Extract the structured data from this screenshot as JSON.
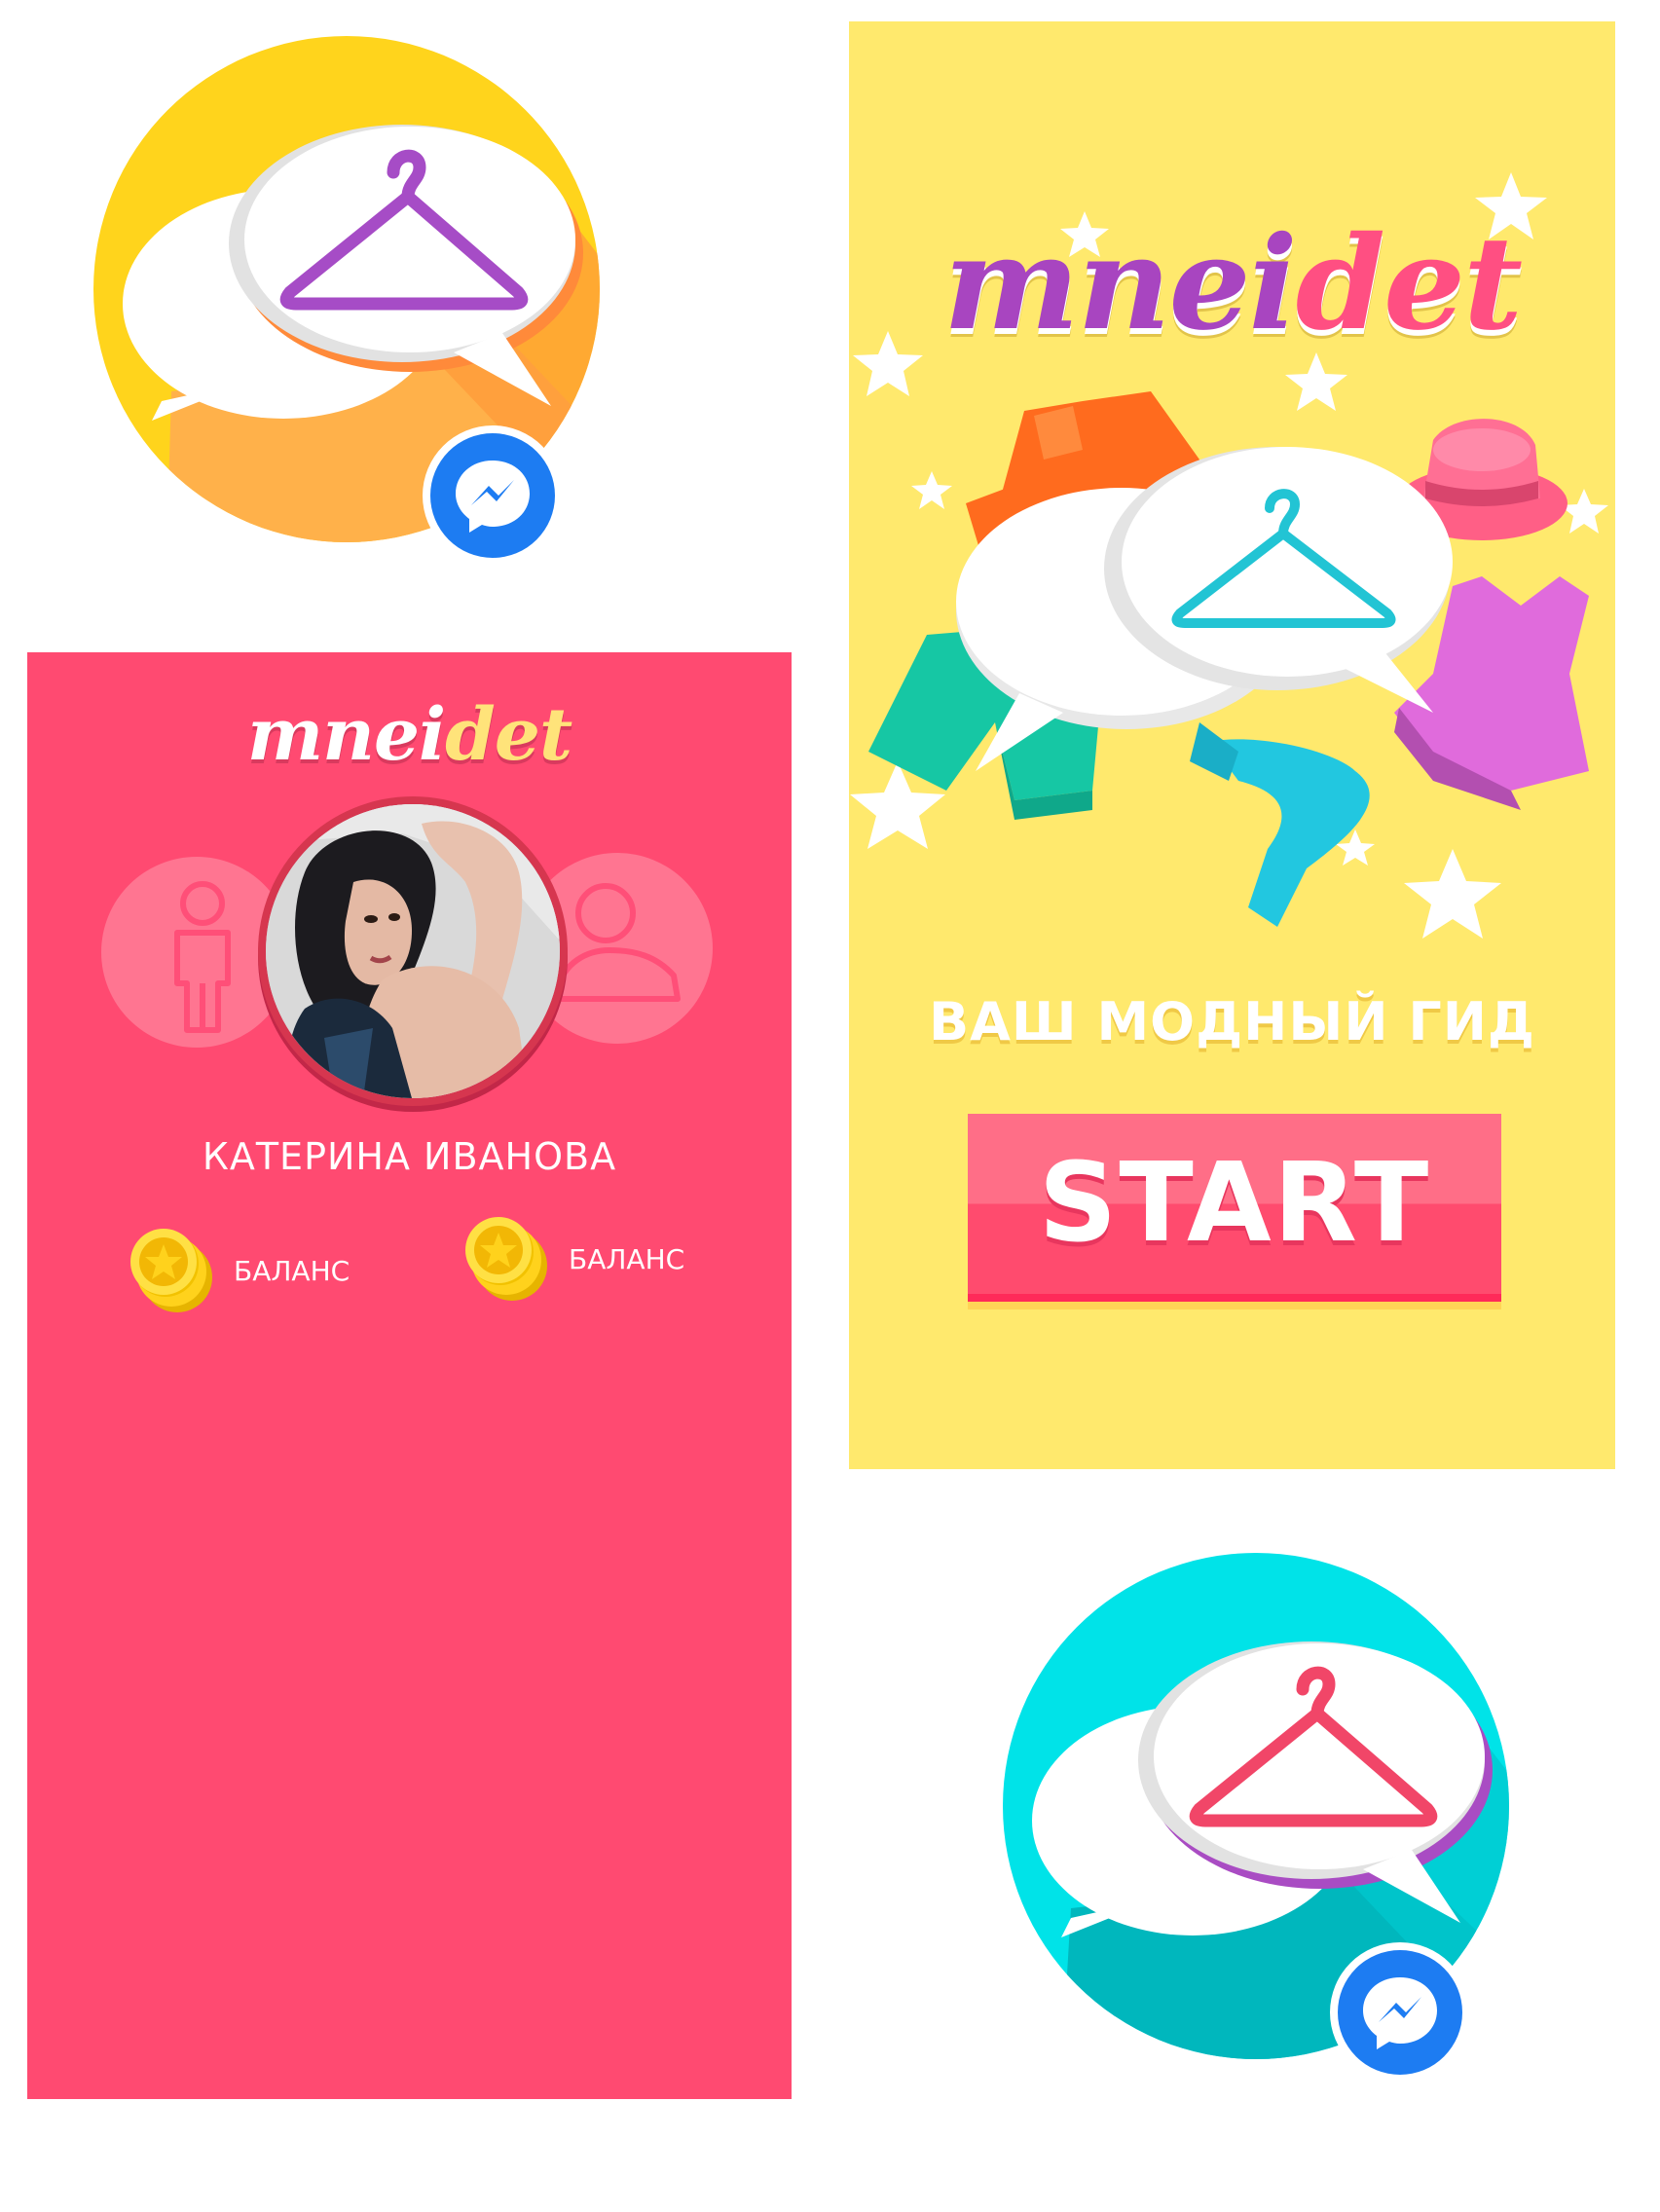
{
  "profile_screen": {
    "logo_part1": "mnei",
    "logo_part2": "det",
    "user_name": "КАТЕРИНА ИВАНОВА",
    "balance_items": [
      {
        "label": "БАЛАНС"
      },
      {
        "label": "БАЛАНС"
      }
    ],
    "colors": {
      "background": "#ff4a71",
      "accent": "#ffe37a"
    }
  },
  "start_screen": {
    "logo_part1": "mnei",
    "logo_part2": "det",
    "tagline": "ВАШ МОДНЫЙ ГИД",
    "start_label": "START",
    "colors": {
      "background": "#ffe96d",
      "button": "#ff4b6e",
      "logo_purple": "#a845c0",
      "logo_pink": "#ff4f82"
    }
  },
  "icons": {
    "top_app_icon": {
      "color": "#ffd41c",
      "hanger_color": "#a64cc6",
      "badge": "messenger-icon"
    },
    "bottom_app_icon": {
      "color": "#00dbe0",
      "hanger_color": "#f14668",
      "badge": "messenger-icon"
    }
  }
}
